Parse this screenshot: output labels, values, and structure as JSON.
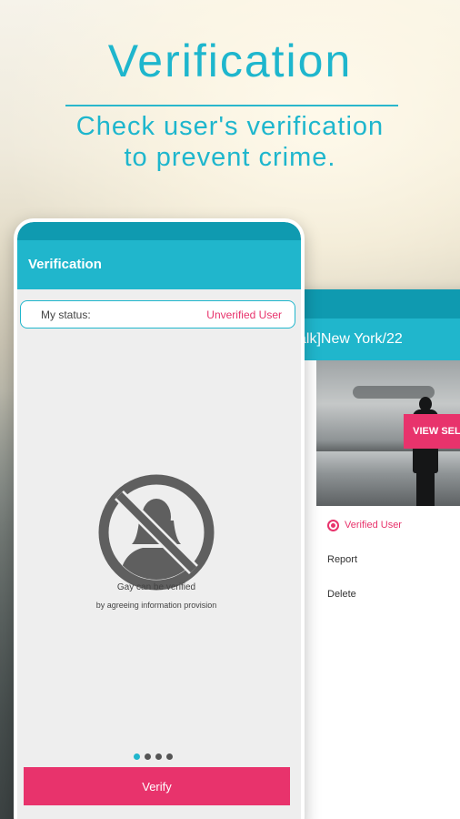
{
  "promo": {
    "headline": "Verification",
    "subline1": "Check user's verification",
    "subline2": "to prevent crime."
  },
  "back_screen": {
    "title": "alk]New York/22",
    "view_selfie_label": "VIEW SELFIE",
    "verified_label": "Verified User",
    "menu": [
      {
        "label": "Report"
      },
      {
        "label": "Delete"
      }
    ]
  },
  "front_screen": {
    "title": "Verification",
    "status": {
      "label": "My status:",
      "value": "Unverified User"
    },
    "caption_line1": "Gay can be verified",
    "caption_line2": "by agreeing information provision",
    "pager": {
      "count": 4,
      "active": 0
    },
    "verify_button": "Verify"
  },
  "colors": {
    "accent": "#20b6cc",
    "accent_dark": "#0f9ab0",
    "pink": "#e8336c"
  }
}
